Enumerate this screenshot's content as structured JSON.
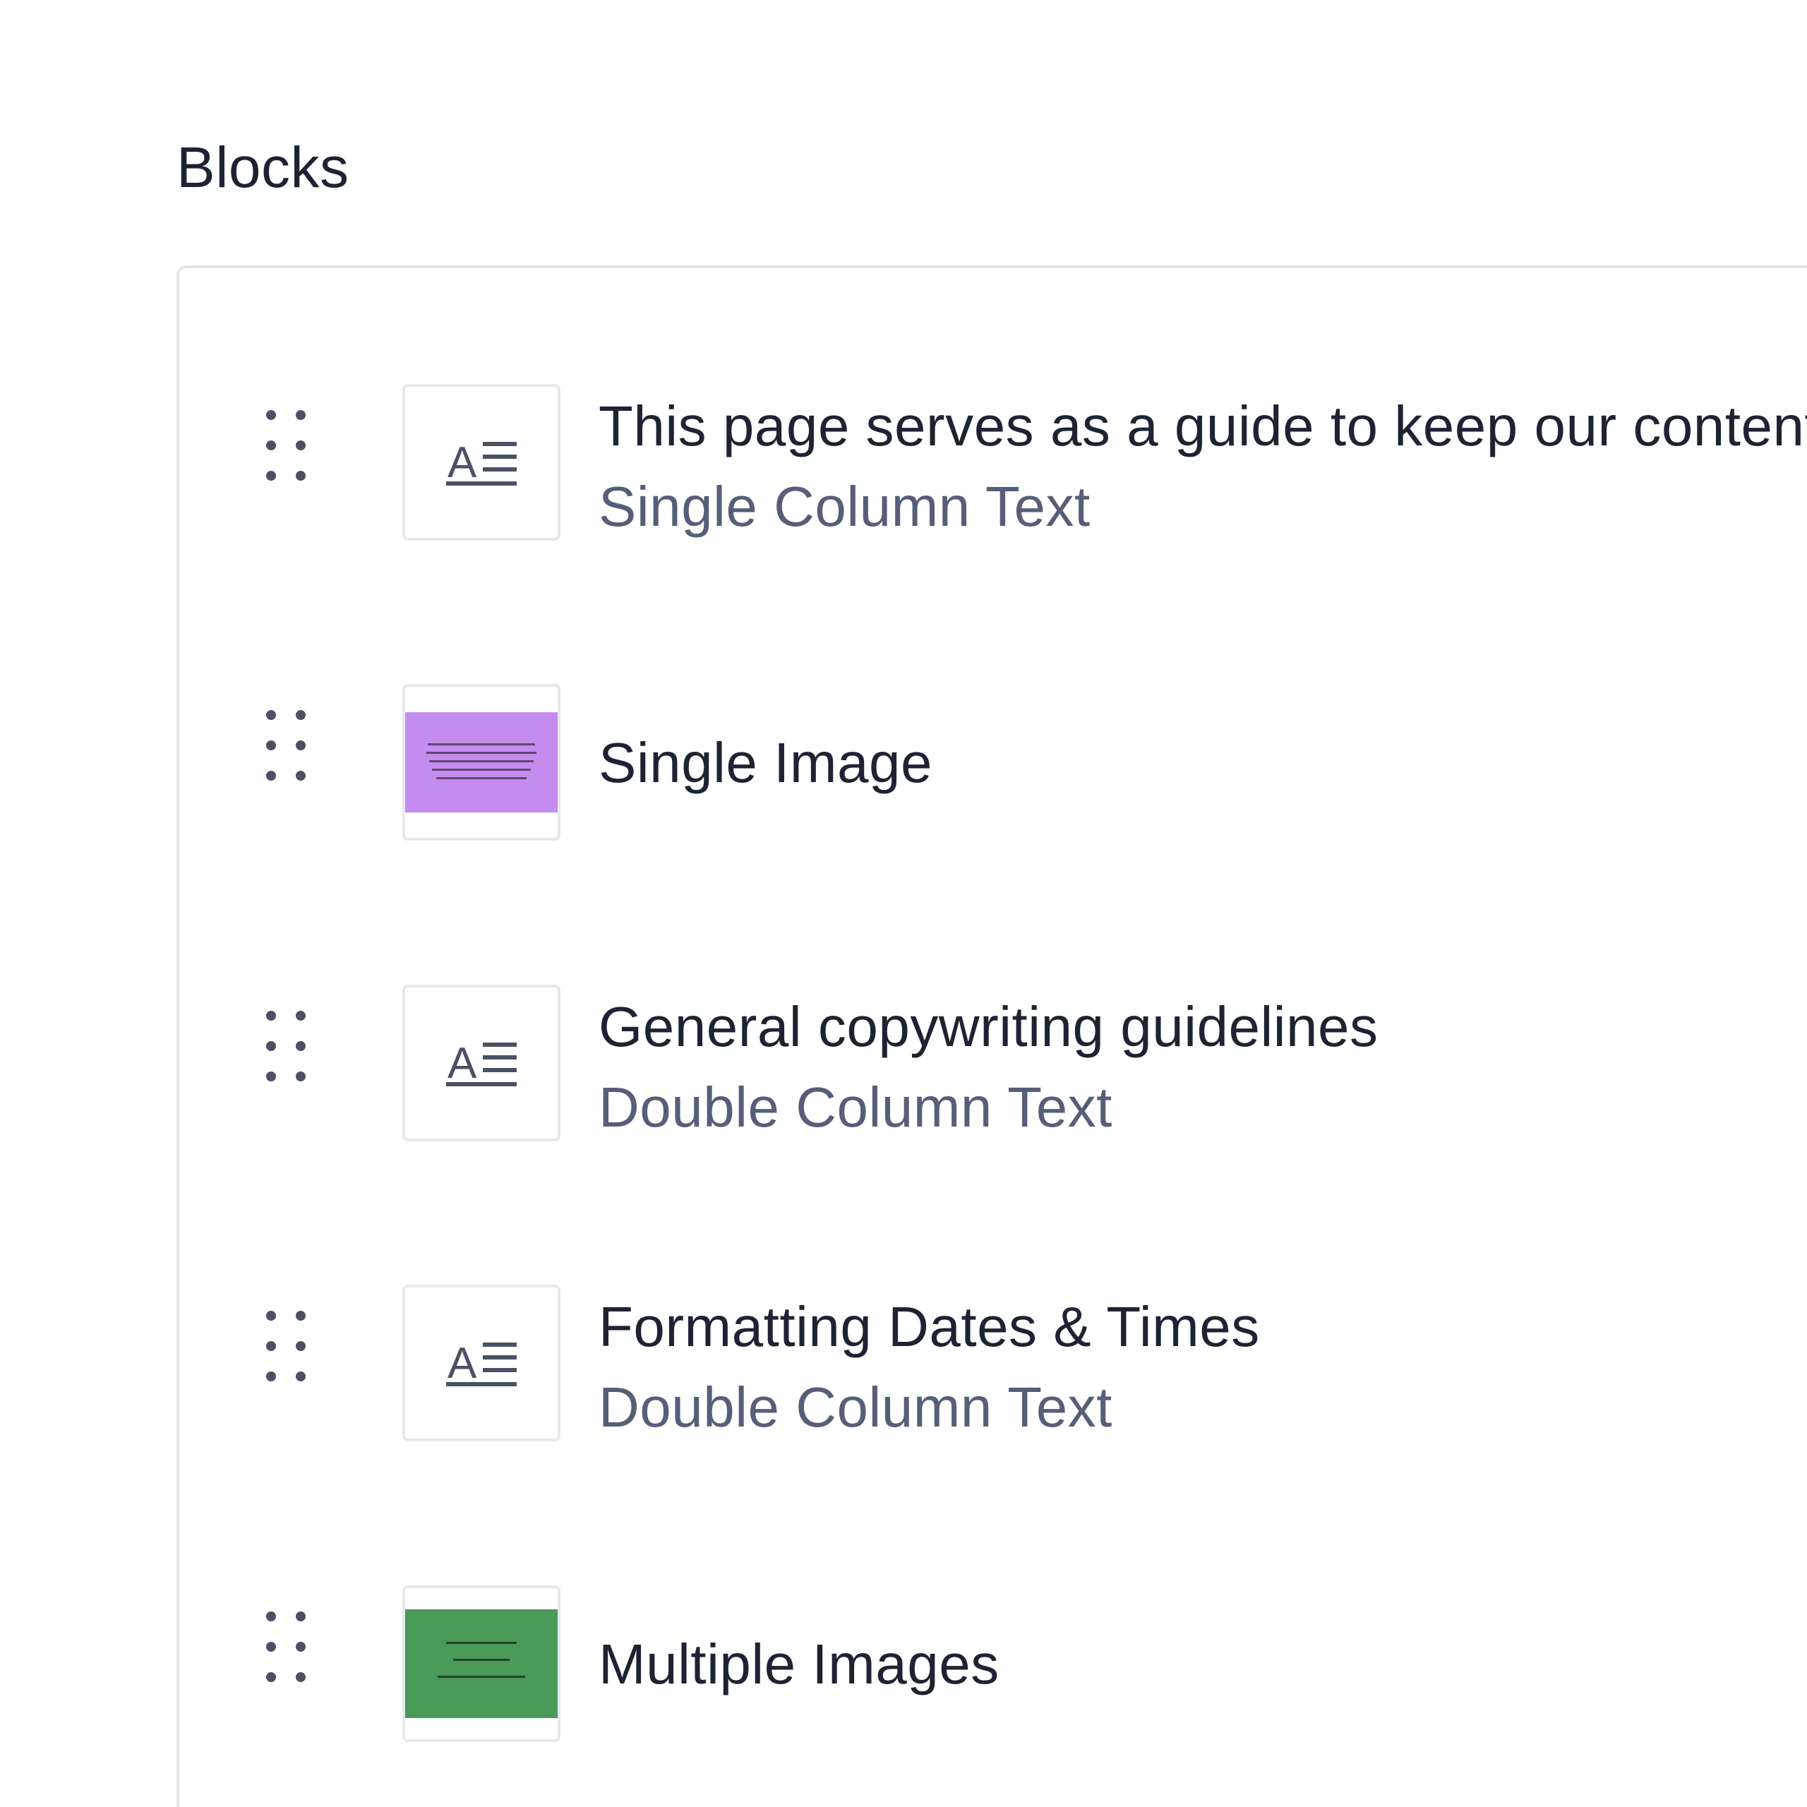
{
  "section": {
    "title": "Blocks"
  },
  "blocks": [
    {
      "title": "This page serves as a guide to keep our content consistent",
      "subtitle": "Single Column Text",
      "icon": "text-block-icon"
    },
    {
      "title": "Single Image",
      "subtitle": "",
      "icon": "image-thumbnail",
      "thumb_color": "#c58cf0"
    },
    {
      "title": "General copywriting guidelines",
      "subtitle": "Double Column Text",
      "icon": "text-block-icon"
    },
    {
      "title": "Formatting Dates & Times",
      "subtitle": "Double Column Text",
      "icon": "text-block-icon"
    },
    {
      "title": "Multiple Images",
      "subtitle": "",
      "icon": "image-thumbnail",
      "thumb_color": "#4a9a5a"
    }
  ],
  "colors": {
    "text_primary": "#1e2333",
    "text_secondary": "#565e78",
    "border": "#e3e5ea",
    "handle_dots": "#4b5063"
  }
}
